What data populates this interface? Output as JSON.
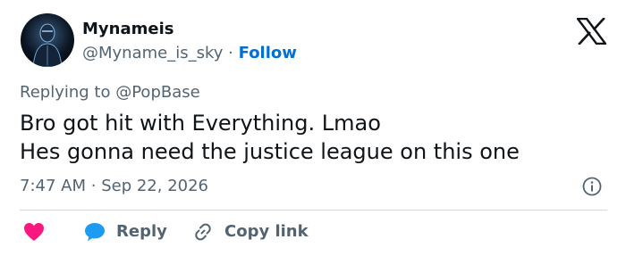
{
  "tweet": {
    "author_name": "Mynameis",
    "author_handle": "@Myname_is_sky",
    "separator": "·",
    "follow_label": "Follow",
    "replying_prefix": "Replying to",
    "replying_handle": "@PopBase",
    "text_lines": [
      "Bro got hit with Everything. Lmao",
      "Hes gonna need the justice league on this one"
    ],
    "time": "7:47 AM",
    "date": "Sep 22, 2026"
  },
  "actions": {
    "like_icon": "heart-icon",
    "reply_label": "Reply",
    "reply_icon": "speech-bubble-icon",
    "copy_label": "Copy link",
    "copy_icon": "link-icon"
  },
  "icons": {
    "brand": "x-logo-icon",
    "info": "info-icon"
  },
  "colors": {
    "follow": "#006fd6",
    "heart": "#f91880",
    "reply_bubble": "#1d9bf0",
    "secondary_text": "#536471",
    "primary_text": "#0f1419",
    "divider": "#cfd9de"
  }
}
